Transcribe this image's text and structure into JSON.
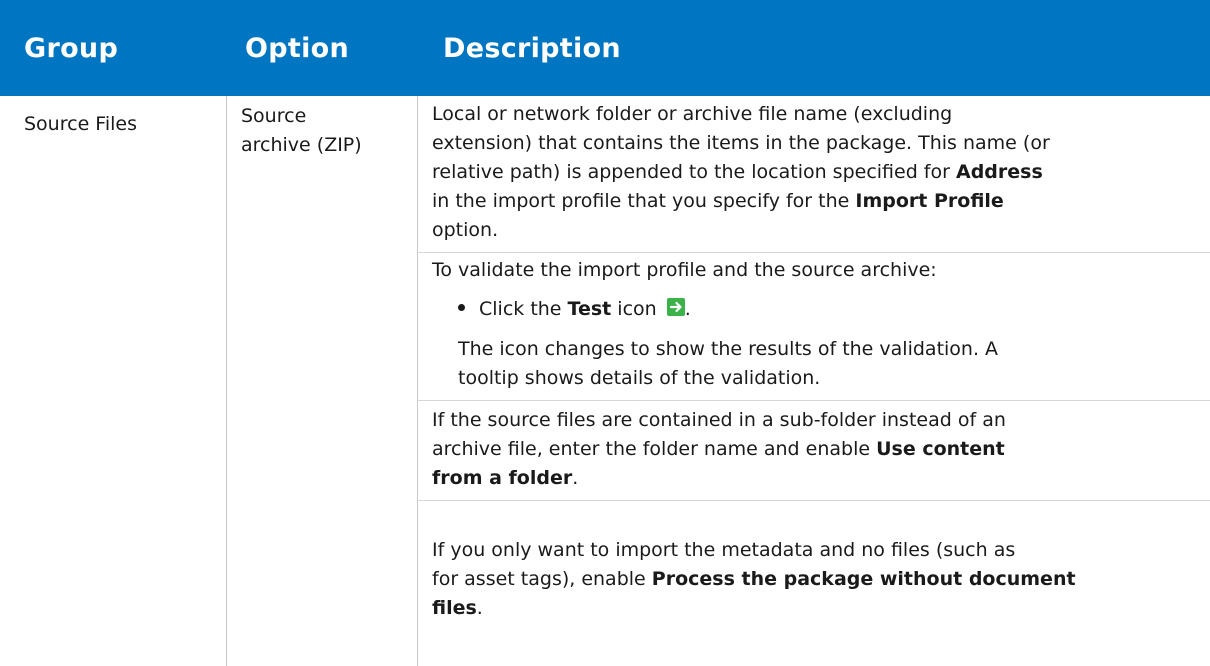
{
  "header": {
    "group": "Group",
    "option": "Option",
    "description": "Description"
  },
  "row": {
    "group": "Source Files",
    "option_line1": "Source",
    "option_line2": "archive (ZIP)",
    "desc": {
      "p1": {
        "l1": "Local or network folder or archive file name (excluding",
        "l2": "extension) that contains the items in the package. This name (or",
        "l3a": "relative path) is appended to the location specified for ",
        "l3b": "Address",
        "l4a": "in the import profile that you specify for the ",
        "l4b": "Import Profile",
        "l5": "option."
      },
      "p2": "To validate the import profile and the source archive:",
      "bullet": {
        "a": "Click the ",
        "b": "Test",
        "c": " icon ",
        "d": ".",
        "icon": "green-arrow-right-icon"
      },
      "p3": {
        "l1": "The icon changes to show the results of the validation. A",
        "l2": "tooltip shows details of the validation."
      },
      "p4": {
        "l1": "If the source files are contained in a sub-folder instead of an",
        "l2a": "archive file, enter the folder name and enable ",
        "l2b": "Use content",
        "l3a": "from a folder",
        "l3b": "."
      },
      "p5": {
        "l1": "If you only want to import the metadata and no files (such as",
        "l2a": "for asset tags), enable ",
        "l2b": "Process the package without document",
        "l3a": "files",
        "l3b": "."
      }
    }
  },
  "colors": {
    "header_bg": "#0075c2",
    "header_text": "#ffffff",
    "test_icon": "#3bb24a"
  }
}
